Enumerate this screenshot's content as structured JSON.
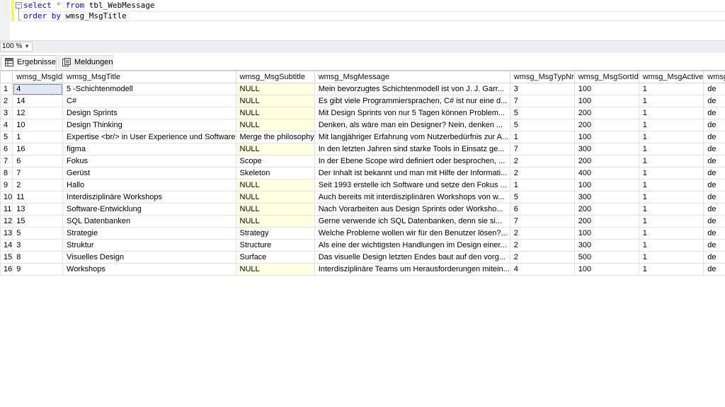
{
  "editor": {
    "line1": {
      "kw1": "select",
      "op": "*",
      "kw2": "from",
      "ident": "tbl_WebMessage"
    },
    "line2": {
      "kw1": "order by",
      "ident": "wmsg_MsgTitle"
    }
  },
  "zoom": {
    "value": "100 %"
  },
  "tabs": [
    {
      "label": "Ergebnisse",
      "icon": "grid-icon",
      "active": true
    },
    {
      "label": "Meldungen",
      "icon": "messages-icon",
      "active": false
    }
  ],
  "grid": {
    "columns": [
      "",
      "wmsg_MsgId",
      "wmsg_MsgTitle",
      "wmsg_MsgSubtitle",
      "wmsg_MsgMessage",
      "wmsg_MsgTypNr",
      "wmsg_MsgSortId",
      "wmsg_MsgActive",
      "wmsg_MsgL"
    ],
    "rows": [
      [
        "1",
        "4",
        "5 -Schichtenmodell",
        "NULL",
        "Mein bevorzugtes Schichtenmodell ist von J. J. Garr...",
        "3",
        "100",
        "1",
        "de"
      ],
      [
        "2",
        "14",
        "C#",
        "NULL",
        "Es gibt viele Programmiersprachen, C# ist nur eine d...",
        "7",
        "100",
        "1",
        "de"
      ],
      [
        "3",
        "12",
        "Design Sprints",
        "NULL",
        "Mit Design Sprints von nur 5 Tagen können Problem...",
        "5",
        "200",
        "1",
        "de"
      ],
      [
        "4",
        "10",
        "Design Thinking",
        "NULL",
        "Denken, als wäre man ein Designer? Nein, denken ...",
        "5",
        "200",
        "1",
        "de"
      ],
      [
        "5",
        "1",
        "Expertise <br/> in User Experience und Software",
        "Merge the philosophy",
        "Mit langjähriger Erfahrung vom Nutzerbedürfnis zur A...",
        "1",
        "100",
        "1",
        "de"
      ],
      [
        "6",
        "16",
        "figma",
        "NULL",
        "In den letzten Jahren sind starke Tools in Einsatz ge...",
        "7",
        "300",
        "1",
        "de"
      ],
      [
        "7",
        "6",
        "Fokus",
        "Scope",
        "In der Ebene Scope wird definiert oder besprochen, ...",
        "2",
        "200",
        "1",
        "de"
      ],
      [
        "8",
        "7",
        "Gerüst",
        "Skeleton",
        "Der Inhalt ist bekannt und man mit Hilfe der Informati...",
        "2",
        "400",
        "1",
        "de"
      ],
      [
        "9",
        "2",
        "Hallo",
        "NULL",
        "Seit 1993 erstelle ich Software und setze den Fokus ...",
        "1",
        "100",
        "1",
        "de"
      ],
      [
        "10",
        "11",
        "Interdisziplinäre Workshops",
        "NULL",
        "Auch bereits mit interdisziplinären Workshops von w...",
        "5",
        "300",
        "1",
        "de"
      ],
      [
        "11",
        "13",
        "Software-Entwicklung",
        "NULL",
        "Nach Vorarbeiten aus Design Sprints oder Worksho...",
        "6",
        "200",
        "1",
        "de"
      ],
      [
        "12",
        "15",
        "SQL Datenbanken",
        "NULL",
        "Gerne verwende ich SQL Datenbanken, denn sie si...",
        "7",
        "200",
        "1",
        "de"
      ],
      [
        "13",
        "5",
        "Strategie",
        "Strategy",
        "Welche Probleme wollen wir für den Benutzer lösen?...",
        "2",
        "100",
        "1",
        "de"
      ],
      [
        "14",
        "3",
        "Struktur",
        "Structure",
        "Als eine der wichtigsten Handlungen im Design einer...",
        "2",
        "300",
        "1",
        "de"
      ],
      [
        "15",
        "8",
        "Visuelles Design",
        "Surface",
        "Das visuelle Design letzten Endes baut auf den vorg...",
        "2",
        "500",
        "1",
        "de"
      ],
      [
        "16",
        "9",
        "Workshops",
        "NULL",
        "Interdisziplinäre Teams um Herausforderungen mitein...",
        "4",
        "100",
        "1",
        "de"
      ]
    ]
  },
  "colors": {
    "keyword": "#0000ff",
    "null_cell_bg": "#ffffe1",
    "selected_cell_bg": "#dfe9f5",
    "changebar": "#ffef70"
  }
}
